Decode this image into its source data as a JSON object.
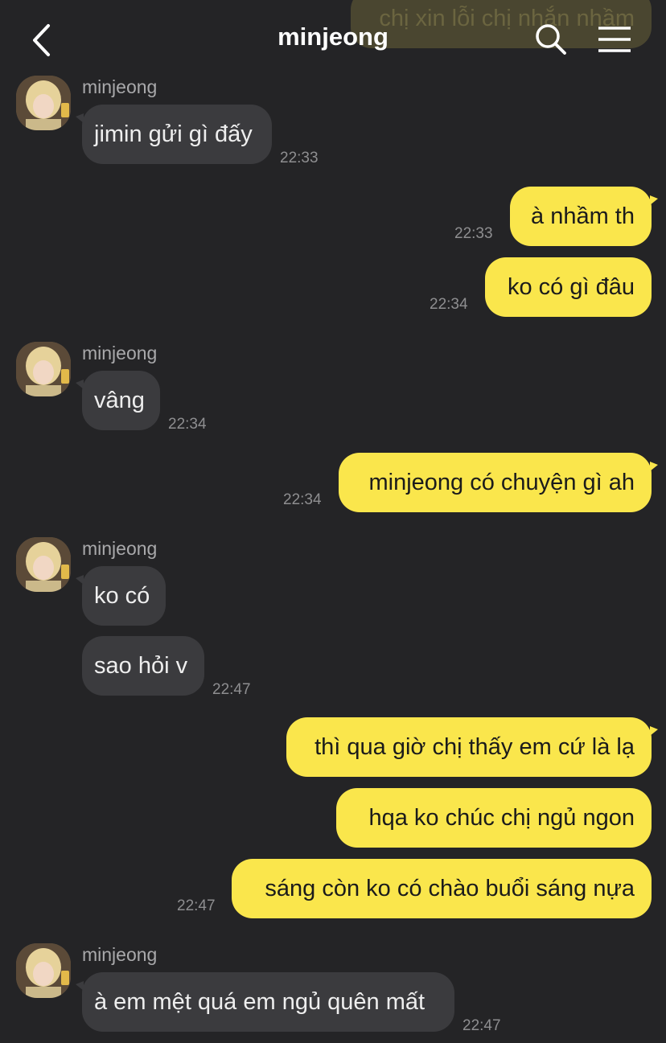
{
  "header": {
    "title": "minjeong",
    "back_icon": "chevron-left-icon",
    "search_icon": "search-icon",
    "menu_icon": "menu-icon"
  },
  "colors": {
    "background": "#242426",
    "incoming_bubble": "#3b3b3e",
    "outgoing_bubble": "#fae64c",
    "timestamp": "#8e8e90"
  },
  "messages": {
    "m0": {
      "text": "chị xin lỗi chị nhắn nhầm"
    },
    "m1": {
      "sender": "minjeong",
      "text": "jimin gửi gì đấy",
      "time": "22:33"
    },
    "m2": {
      "text": "à nhầm th",
      "time": "22:33"
    },
    "m3": {
      "text": "ko có gì đâu",
      "time": "22:34"
    },
    "m4": {
      "sender": "minjeong",
      "text": "vâng",
      "time": "22:34"
    },
    "m5": {
      "text": "minjeong có chuyện gì ah",
      "time": "22:34"
    },
    "m6": {
      "sender": "minjeong",
      "text": "ko có"
    },
    "m7": {
      "text": "sao hỏi v",
      "time": "22:47"
    },
    "m8": {
      "text": "thì qua giờ chị thấy em cứ là lạ"
    },
    "m9": {
      "text": "hqa ko chúc chị ngủ ngon"
    },
    "m10": {
      "text": "sáng còn ko có chào buổi sáng nựa",
      "time": "22:47"
    },
    "m11": {
      "sender": "minjeong",
      "text": "à em mệt quá em ngủ quên mất",
      "time": "22:47"
    }
  }
}
